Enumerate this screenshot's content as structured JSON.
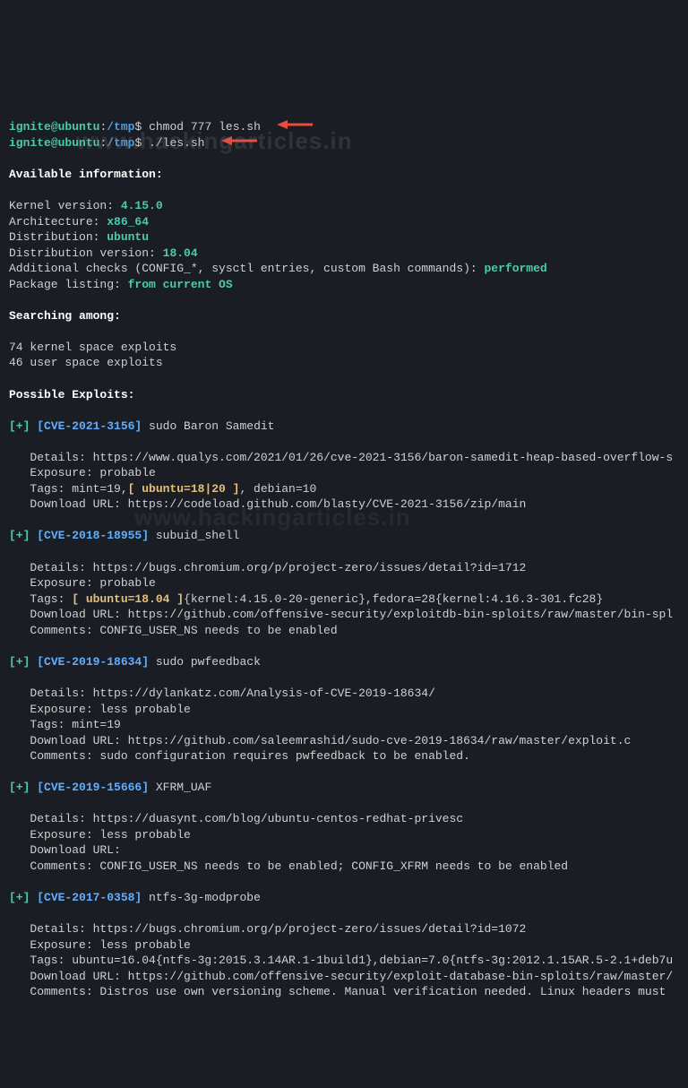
{
  "prompt": {
    "user": "ignite",
    "host": "ubuntu",
    "path": "/tmp",
    "cmd1": "chmod 777 les.sh",
    "cmd2": "./les.sh"
  },
  "watermark": "www.hackingarticles.in",
  "watermark2": "www.hackingarticles.in",
  "sections": {
    "avail_header": "Available information:",
    "kernel_label": "Kernel version: ",
    "kernel_value": "4.15.0",
    "arch_label": "Architecture: ",
    "arch_value": "x86_64",
    "dist_label": "Distribution: ",
    "dist_value": "ubuntu",
    "distver_label": "Distribution version: ",
    "distver_value": "18.04",
    "addchecks_label": "Additional checks (CONFIG_*, sysctl entries, custom Bash commands): ",
    "addchecks_value": "performed",
    "pkg_label": "Package listing: ",
    "pkg_value": "from current OS",
    "search_header": "Searching among:",
    "search_line1": "74 kernel space exploits",
    "search_line2": "46 user space exploits",
    "exploits_header": "Possible Exploits:"
  },
  "exploits": [
    {
      "cve": "[CVE-2021-3156]",
      "name": " sudo Baron Samedit",
      "details": "   Details: https://www.qualys.com/2021/01/26/cve-2021-3156/baron-samedit-heap-based-overflow-s",
      "exposure": "   Exposure: probable",
      "tags_pre": "   Tags: mint=19,",
      "tags_hl": "[ ubuntu=18|20 ]",
      "tags_post": ", debian=10",
      "download": "   Download URL: https://codeload.github.com/blasty/CVE-2021-3156/zip/main",
      "comments": ""
    },
    {
      "cve": "[CVE-2018-18955]",
      "name": " subuid_shell",
      "details": "   Details: https://bugs.chromium.org/p/project-zero/issues/detail?id=1712",
      "exposure": "   Exposure: probable",
      "tags_pre": "   Tags: ",
      "tags_hl": "[ ubuntu=18.04 ]",
      "tags_post": "{kernel:4.15.0-20-generic},fedora=28{kernel:4.16.3-301.fc28}",
      "download": "   Download URL: https://github.com/offensive-security/exploitdb-bin-sploits/raw/master/bin-spl",
      "comments": "   Comments: CONFIG_USER_NS needs to be enabled"
    },
    {
      "cve": "[CVE-2019-18634]",
      "name": " sudo pwfeedback",
      "details": "   Details: https://dylankatz.com/Analysis-of-CVE-2019-18634/",
      "exposure": "   Exposure: less probable",
      "tags_pre": "   Tags: mint=19",
      "tags_hl": "",
      "tags_post": "",
      "download": "   Download URL: https://github.com/saleemrashid/sudo-cve-2019-18634/raw/master/exploit.c",
      "comments": "   Comments: sudo configuration requires pwfeedback to be enabled."
    },
    {
      "cve": "[CVE-2019-15666]",
      "name": " XFRM_UAF",
      "details": "   Details: https://duasynt.com/blog/ubuntu-centos-redhat-privesc",
      "exposure": "   Exposure: less probable",
      "tags_pre": "",
      "tags_hl": "",
      "tags_post": "",
      "download": "   Download URL:",
      "comments": "   Comments: CONFIG_USER_NS needs to be enabled; CONFIG_XFRM needs to be enabled"
    },
    {
      "cve": "[CVE-2017-0358]",
      "name": " ntfs-3g-modprobe",
      "details": "   Details: https://bugs.chromium.org/p/project-zero/issues/detail?id=1072",
      "exposure": "   Exposure: less probable",
      "tags_pre": "   Tags: ubuntu=16.04{ntfs-3g:2015.3.14AR.1-1build1},debian=7.0{ntfs-3g:2012.1.15AR.5-2.1+deb7u",
      "tags_hl": "",
      "tags_post": "",
      "download": "   Download URL: https://github.com/offensive-security/exploit-database-bin-sploits/raw/master/",
      "comments": "   Comments: Distros use own versioning scheme. Manual verification needed. Linux headers must"
    }
  ]
}
